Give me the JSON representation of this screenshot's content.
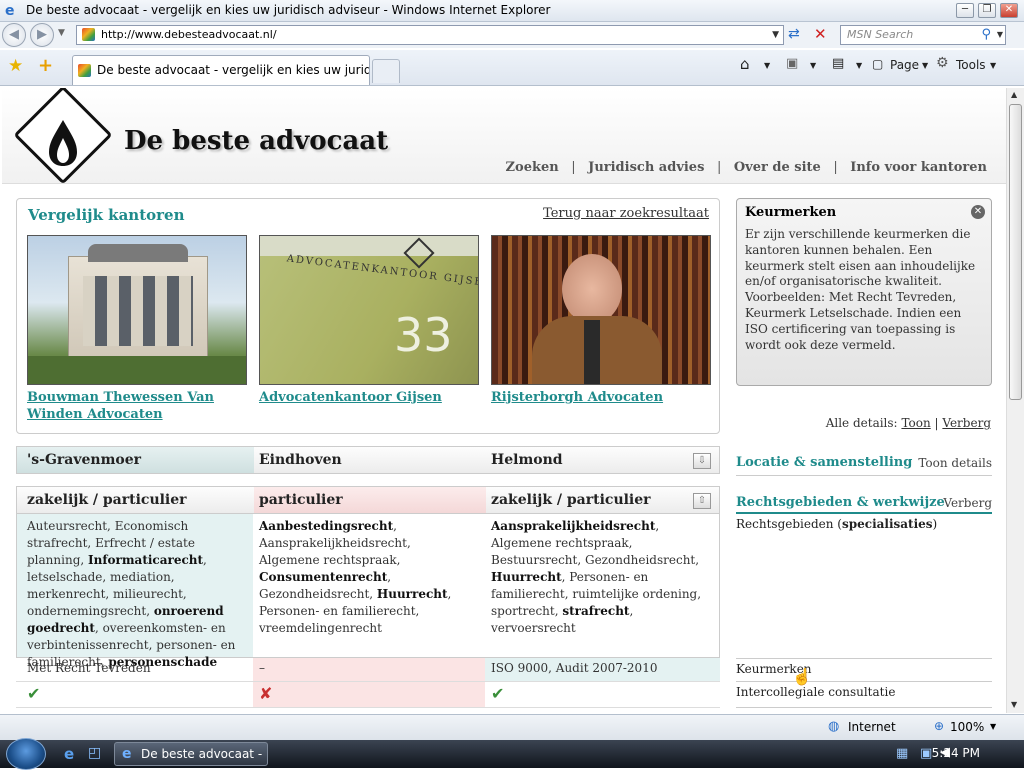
{
  "window": {
    "title": "De beste advocaat - vergelijk en kies uw juridisch adviseur - Windows Internet Explorer",
    "min": "─",
    "max": "❐",
    "close": "✕"
  },
  "nav": {
    "url": "http://www.debesteadvocaat.nl/",
    "search_placeholder": "MSN Search"
  },
  "tabs": {
    "active": "De beste advocaat - vergelijk en kies uw juridisc...",
    "page_label": "Page",
    "tools_label": "Tools"
  },
  "site": {
    "name": "De beste advocaat",
    "nav": [
      "Zoeken",
      "Juridisch advies",
      "Over de site",
      "Info voor kantoren"
    ],
    "separator": "|"
  },
  "compare": {
    "title": "Vergelijk kantoren",
    "back": "Terug naar zoekresultaat",
    "firms": [
      {
        "name": "Bouwman Thewessen Van Winden Advocaten",
        "city": "'s-Gravenmoer",
        "type": "zakelijk / particulier",
        "keurmerk": "Met Recht Tevreden"
      },
      {
        "name": "Advocatenkantoor Gijsen",
        "city": "Eindhoven",
        "type": "particulier",
        "keurmerk": "–"
      },
      {
        "name": "Rijsterborgh Advocaten",
        "city": "Helmond",
        "type": "zakelijk / particulier",
        "keurmerk": "ISO 9000, Audit 2007-2010"
      }
    ],
    "photo2_text": "ADVOCATENKANTOOR GIJSEN",
    "photo2_number": "33"
  },
  "keurmerken_box": {
    "title": "Keurmerken",
    "close": "✕",
    "text": "Er zijn verschillende keurmerken die kantoren kunnen behalen. Een keurmerk stelt eisen aan inhoudelijke en/of organisatorische kwaliteit. Voorbeelden: Met Recht Tevreden, Keurmerk Letselschade. Indien een ISO certificering van toepassing is wordt ook deze vermeld."
  },
  "details": {
    "label": "Alle details:",
    "show": "Toon",
    "sep": "|",
    "hide": "Verberg"
  },
  "sections": {
    "locatie": {
      "title": "Locatie & samenstelling",
      "action": "Toon details"
    },
    "rechtsgebieden": {
      "title": "Rechtsgebieden & werkwijze",
      "action": "Verberg"
    },
    "spec_label_prefix": "Rechtsgebieden (",
    "spec_label_bold": "specialisaties",
    "spec_label_suffix": ")",
    "row_keurmerken": "Keurmerken",
    "row_consultatie": "Intercollegiale consultatie"
  },
  "areas": {
    "col1": [
      {
        "t": "Auteursrecht, ",
        "b": false
      },
      {
        "t": "Economisch strafrecht, ",
        "b": false
      },
      {
        "t": "Erfrecht / estate planning, ",
        "b": false
      },
      {
        "t": "Informaticarecht",
        "b": true
      },
      {
        "t": ", letselschade, mediation, merkenrecht, milieurecht, ondernemingsrecht, ",
        "b": false
      },
      {
        "t": "onroerend goedrecht",
        "b": true
      },
      {
        "t": ", overeenkomsten- en verbintenissenrecht, personen- en familierecht, ",
        "b": false
      },
      {
        "t": "personenschade",
        "b": true
      }
    ],
    "col2": [
      {
        "t": "Aanbestedingsrecht",
        "b": true
      },
      {
        "t": ", Aansprakelijkheidsrecht, Algemene rechtspraak, ",
        "b": false
      },
      {
        "t": "Consumentenrecht",
        "b": true
      },
      {
        "t": ", Gezondheidsrecht, ",
        "b": false
      },
      {
        "t": "Huurrecht",
        "b": true
      },
      {
        "t": ", Personen- en familierecht, vreemdelingenrecht",
        "b": false
      }
    ],
    "col3": [
      {
        "t": "Aansprakelijkheidsrecht",
        "b": true
      },
      {
        "t": ", Algemene rechtspraak, Bestuursrecht, Gezondheidsrecht, ",
        "b": false
      },
      {
        "t": "Huurrecht",
        "b": true
      },
      {
        "t": ", Personen- en familierecht, ruimtelijke ordening, sportrecht, ",
        "b": false
      },
      {
        "t": "strafrecht",
        "b": true
      },
      {
        "t": ", vervoersrecht",
        "b": false
      }
    ]
  },
  "status": {
    "zone": "Internet",
    "zoom": "100%"
  },
  "taskbar": {
    "item": "De beste advocaat - ...",
    "time": "5:24 PM"
  },
  "colors": {
    "teal": "#1f8b8b",
    "col1_bg": "#e4f2f2",
    "col2_bg": "#fbe4e4",
    "check": "#3a8f3a",
    "cross": "#c83030"
  }
}
